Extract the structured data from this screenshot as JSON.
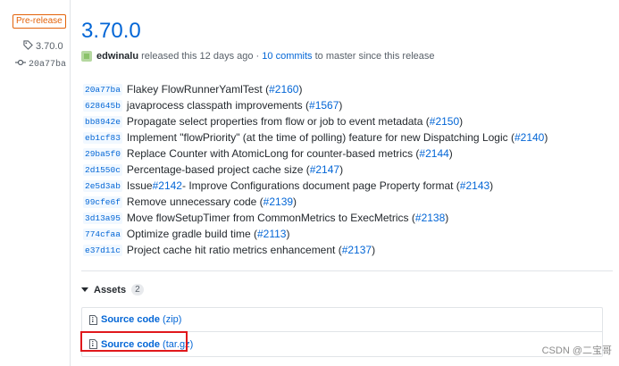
{
  "sidebar": {
    "badge": "Pre-release",
    "tag": "3.70.0",
    "commit": "20a77ba"
  },
  "release": {
    "title": "3.70.0",
    "author": "edwinalu",
    "released_text": "released this 12 days ago ·",
    "commits_link": "10 commits",
    "commits_suffix": "to master since this release"
  },
  "commits": [
    {
      "sha": "20a77ba",
      "message": "Flakey FlowRunnerYamlTest (",
      "ref": "#2160",
      "tail": ")"
    },
    {
      "sha": "628645b",
      "message": "javaprocess classpath improvements (",
      "ref": "#1567",
      "tail": ")"
    },
    {
      "sha": "bb8942e",
      "message": "Propagate select properties from flow or job to event metadata (",
      "ref": "#2150",
      "tail": ")"
    },
    {
      "sha": "eb1cf83",
      "message": "Implement \"flowPriority\" (at the time of polling) feature for new Dispatching Logic (",
      "ref": "#2140",
      "tail": ")"
    },
    {
      "sha": "29ba5f0",
      "message": "Replace Counter with AtomicLong for counter-based metrics (",
      "ref": "#2144",
      "tail": ")"
    },
    {
      "sha": "2d1550c",
      "message": "Percentage-based project cache size (",
      "ref": "#2147",
      "tail": ")"
    },
    {
      "sha": "2e5d3ab",
      "message": "Issue ",
      "ref": "#2142",
      "tail": " - Improve Configurations document page Property format (",
      "ref2": "#2143",
      "tail2": ")"
    },
    {
      "sha": "99cfe6f",
      "message": "Remove unnecessary code (",
      "ref": "#2139",
      "tail": ")"
    },
    {
      "sha": "3d13a95",
      "message": "Move flowSetupTimer from CommonMetrics to ExecMetrics (",
      "ref": "#2138",
      "tail": ")"
    },
    {
      "sha": "774cfaa",
      "message": "Optimize gradle build time (",
      "ref": "#2113",
      "tail": ")"
    },
    {
      "sha": "e37d11c",
      "message": "Project cache hit ratio metrics enhancement (",
      "ref": "#2137",
      "tail": ")"
    }
  ],
  "assets": {
    "label": "Assets",
    "count": "2",
    "items": [
      {
        "name": "Source code",
        "format": "(zip)",
        "icon": "file-zip-icon"
      },
      {
        "name": "Source code",
        "format": "(tar.gz)",
        "icon": "file-zip-icon"
      }
    ]
  },
  "watermark": "CSDN @二宝哥",
  "colors": {
    "link": "#0366d6",
    "prerelease": "#e36209",
    "highlight": "#e0181c"
  }
}
